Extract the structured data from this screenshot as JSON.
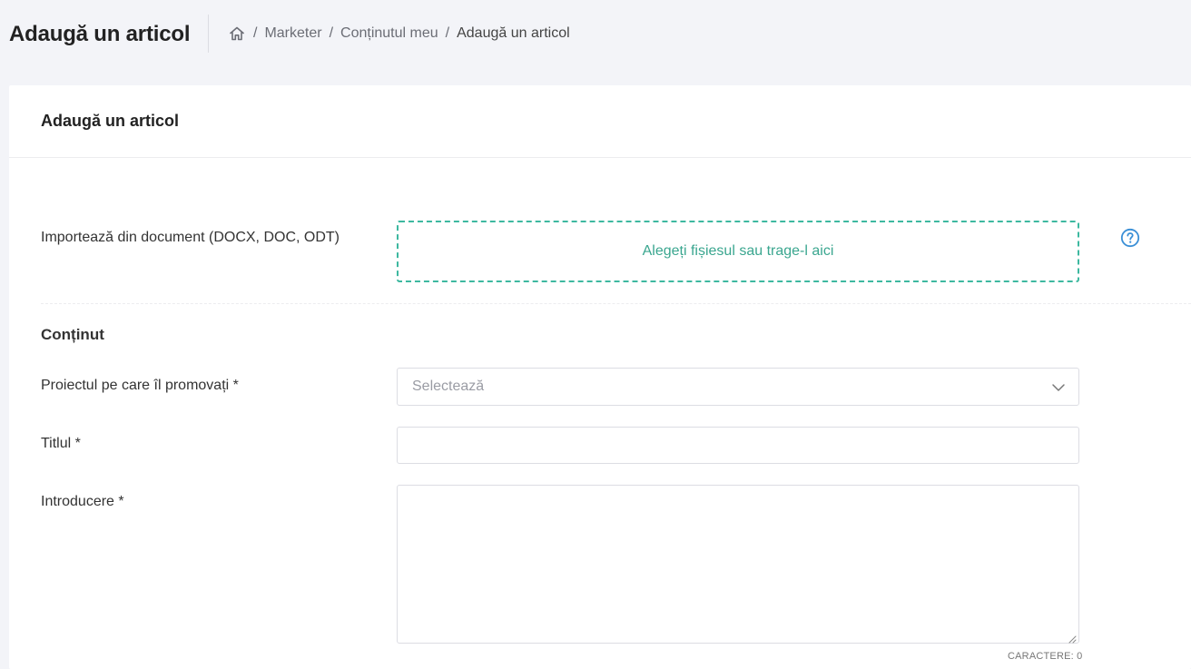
{
  "header": {
    "page_title": "Adaugă un articol",
    "breadcrumb": {
      "home_icon": "home-icon",
      "separator": "/",
      "items": [
        "Marketer",
        "Conținutul meu"
      ],
      "current": "Adaugă un articol"
    }
  },
  "card": {
    "title": "Adaugă un articol",
    "import": {
      "label": "Importează din document (DOCX, DOC, ODT)",
      "dropzone_text": "Alegeți fișiesul sau trage-l aici",
      "help_icon": "question-circle-icon"
    },
    "content_section": {
      "title": "Conținut",
      "project": {
        "label": "Proiectul pe care îl promovați *",
        "placeholder": "Selectează"
      },
      "title_field": {
        "label": "Titlul *",
        "value": ""
      },
      "intro": {
        "label": "Introducere *",
        "value": "",
        "counter_label": "CARACTERE: 0"
      }
    }
  },
  "colors": {
    "accent": "#3db8a0",
    "help_blue": "#3a8fd6",
    "background": "#f3f4f8"
  }
}
